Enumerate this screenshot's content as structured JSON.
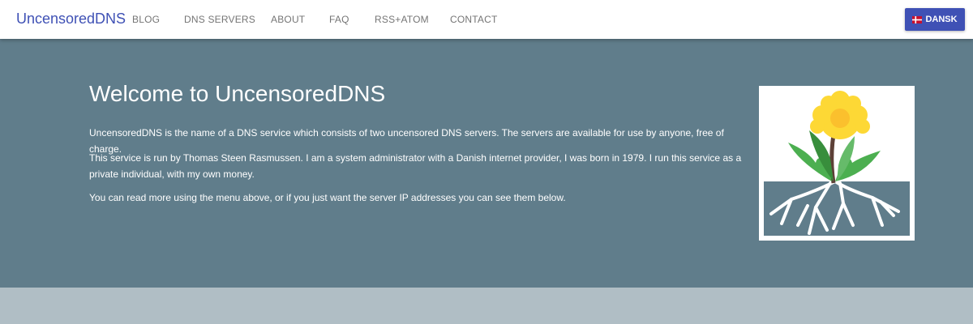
{
  "navbar": {
    "brand": "UncensoredDNS",
    "items": [
      "BLOG",
      "DNS SERVERS",
      "ABOUT",
      "FAQ",
      "RSS+ATOM",
      "CONTACT"
    ],
    "language_button": "DANSK"
  },
  "hero": {
    "title": "Welcome to UncensoredDNS",
    "paragraphs": [
      "UncensoredDNS is the name of a DNS service which consists of two uncensored DNS servers. The servers are available for use by anyone, free of charge.",
      "This service is run by Thomas Steen Rasmussen. I am a system administrator with a Danish internet provider, I was born in 1979. I run this service as a private individual, with my own money.",
      "You can read more using the menu above, or if you just want the server IP addresses you can see them below."
    ]
  },
  "icons": [
    "danish-flag-icon",
    "dandelion-logo-icon"
  ],
  "colors": {
    "brand": "#3f51b5",
    "hero_background": "#607d8b",
    "lower_background": "#b0bec5",
    "navbar_background": "#ffffff"
  }
}
